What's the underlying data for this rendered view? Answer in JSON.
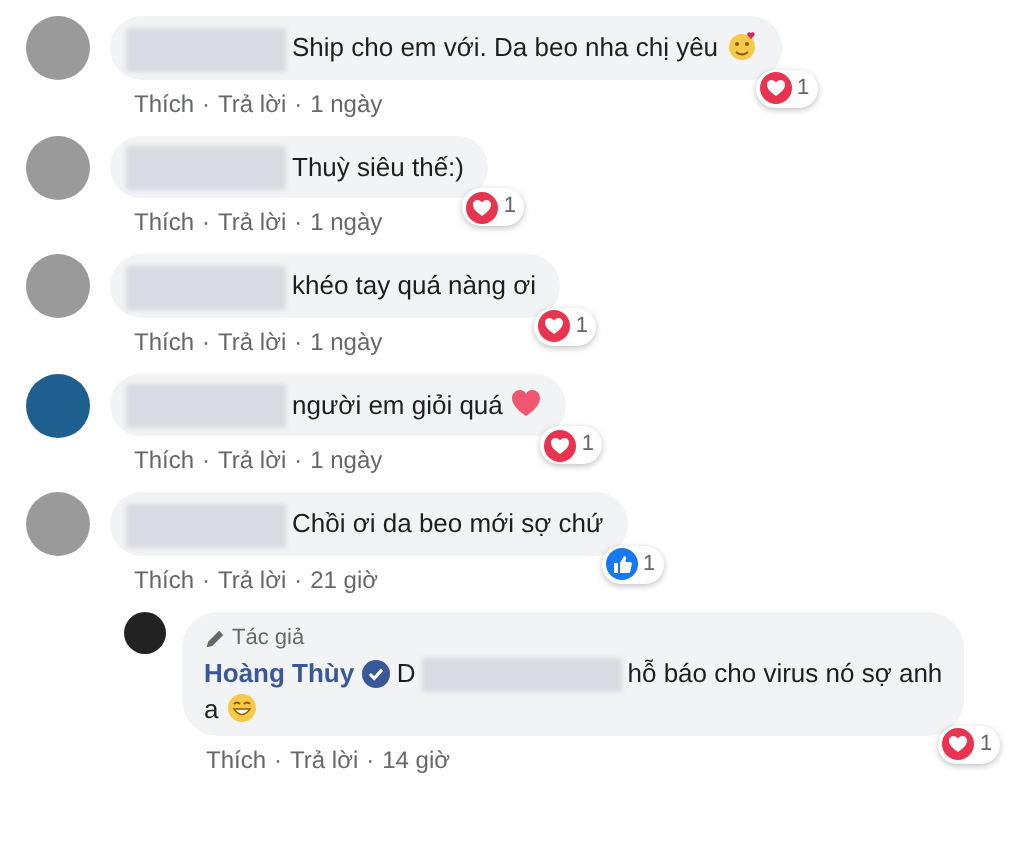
{
  "comments": [
    {
      "reply": false,
      "avatar": {
        "kind": "photo"
      },
      "redacted": true,
      "text_lines": [
        "Ship cho em với. Da beo nha chị yêu"
      ],
      "emoji": {
        "kind": "heart-face"
      },
      "reaction": {
        "kind": "love",
        "count": "1"
      },
      "footer": [
        "Thích",
        "·",
        "Trả lời",
        "·",
        "1 ngày"
      ]
    },
    {
      "reply": false,
      "avatar": {
        "kind": "photo"
      },
      "redacted": true,
      "text_lines": [
        "Thuỳ siêu thế:)"
      ],
      "reaction": {
        "kind": "love",
        "count": "1"
      },
      "footer": [
        "Thích",
        "·",
        "Trả lời",
        "·",
        "1 ngày"
      ]
    },
    {
      "reply": false,
      "avatar": {
        "kind": "photo"
      },
      "redacted": true,
      "text_lines": [
        "khéo tay quá nàng ơi"
      ],
      "reaction": {
        "kind": "love",
        "count": "1"
      },
      "footer": [
        "Thích",
        "·",
        "Trả lời",
        "·",
        "1 ngày"
      ]
    },
    {
      "reply": false,
      "avatar": {
        "kind": "logo"
      },
      "redacted": true,
      "text_lines": [
        "người em giỏi quá"
      ],
      "emoji": {
        "kind": "heart"
      },
      "reaction": {
        "kind": "love",
        "count": "1"
      },
      "footer": [
        "Thích",
        "·",
        "Trả lời",
        "·",
        "1 ngày"
      ]
    },
    {
      "reply": false,
      "avatar": {
        "kind": "photo"
      },
      "redacted": true,
      "text_lines": [
        "Chồi ơi da beo mới sợ chứ"
      ],
      "reaction": {
        "kind": "like",
        "count": "1"
      },
      "footer": [
        "Thích",
        "·",
        "Trả lời",
        "·",
        "21 giờ"
      ]
    },
    {
      "reply": true,
      "avatar": {
        "kind": "photo"
      },
      "author_label": "Tác giả",
      "name": "Hoàng Thùy",
      "verified": true,
      "text_before": "D",
      "redacted": true,
      "text_lines": [
        "hỗ báo cho virus nó sợ anh",
        "a"
      ],
      "emoji": {
        "kind": "grin"
      },
      "reaction": {
        "kind": "love",
        "count": "1"
      },
      "footer": [
        "Thích",
        "·",
        "Trả lời",
        "·",
        "14 giờ"
      ]
    }
  ]
}
